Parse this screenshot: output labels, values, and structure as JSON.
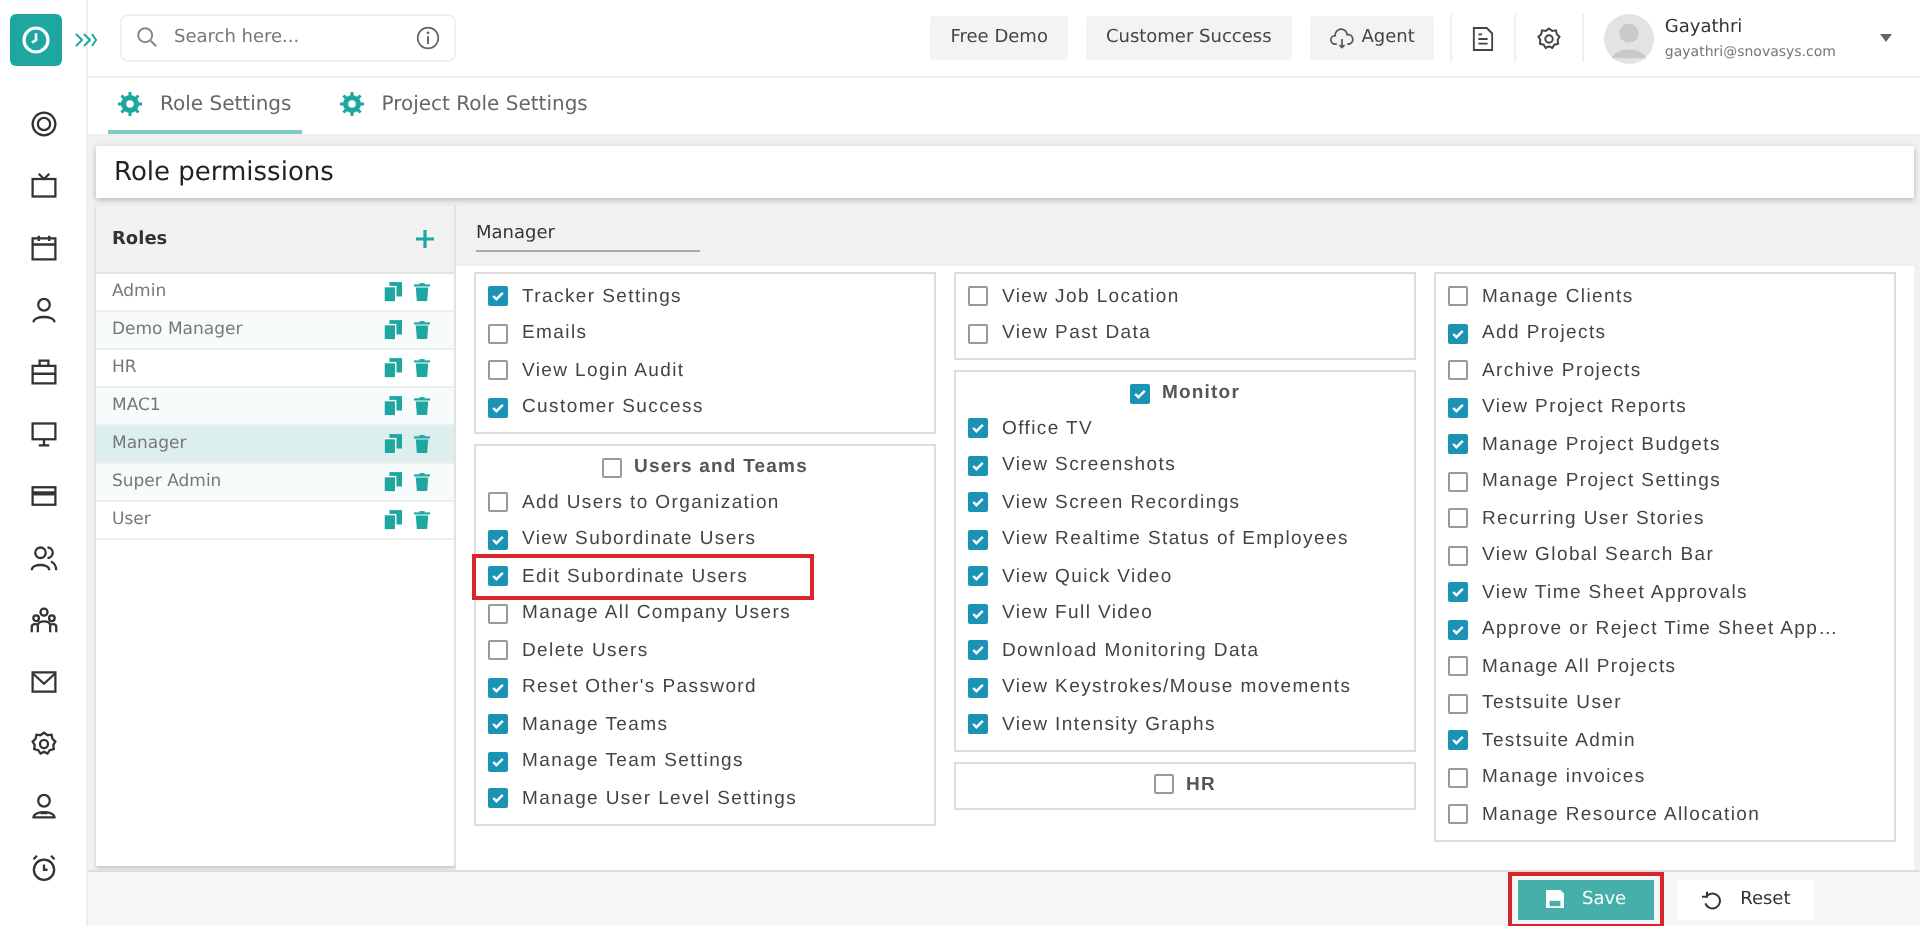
{
  "header": {
    "search_placeholder": "Search here...",
    "buttons": [
      {
        "label": "Free Demo",
        "kind": "plain"
      },
      {
        "label": "Customer Success",
        "kind": "plain"
      },
      {
        "label": "Agent",
        "kind": "cloud"
      }
    ],
    "user": {
      "name": "Gayathri",
      "email": "gayathri@snovasys.com"
    }
  },
  "tabs": [
    {
      "label": "Role Settings",
      "selected": true
    },
    {
      "label": "Project Role Settings",
      "selected": false
    }
  ],
  "page_title": "Role permissions",
  "roles": {
    "title": "Roles",
    "items": [
      {
        "name": "Admin",
        "selected": false
      },
      {
        "name": "Demo Manager",
        "selected": false
      },
      {
        "name": "HR",
        "selected": false
      },
      {
        "name": "MAC1",
        "selected": false
      },
      {
        "name": "Manager",
        "selected": true
      },
      {
        "name": "Super Admin",
        "selected": false
      },
      {
        "name": "User",
        "selected": false
      }
    ]
  },
  "role_select": {
    "value": "Manager"
  },
  "columns": [
    {
      "groups": [
        {
          "items": [
            {
              "label": "Tracker Settings",
              "checked": true,
              "highlighted": false
            },
            {
              "label": "Emails",
              "checked": false,
              "highlighted": false
            },
            {
              "label": "View Login Audit",
              "checked": false,
              "highlighted": false
            },
            {
              "label": "Customer Success",
              "checked": true,
              "highlighted": false
            }
          ]
        },
        {
          "title": "Users and Teams",
          "checked": false,
          "items": [
            {
              "label": "Add Users to Organization",
              "checked": false,
              "highlighted": false
            },
            {
              "label": "View Subordinate Users",
              "checked": true,
              "highlighted": false
            },
            {
              "label": "Edit Subordinate Users",
              "checked": true,
              "highlighted": true
            },
            {
              "label": "Manage All Company Users",
              "checked": false,
              "highlighted": false
            },
            {
              "label": "Delete Users",
              "checked": false,
              "highlighted": false
            },
            {
              "label": "Reset Other's Password",
              "checked": true,
              "highlighted": false
            },
            {
              "label": "Manage Teams",
              "checked": true,
              "highlighted": false
            },
            {
              "label": "Manage Team Settings",
              "checked": true,
              "highlighted": false
            },
            {
              "label": "Manage User Level Settings",
              "checked": true,
              "highlighted": false
            }
          ]
        }
      ]
    },
    {
      "groups": [
        {
          "items": [
            {
              "label": "View Job Location",
              "checked": false,
              "highlighted": false
            },
            {
              "label": "View Past Data",
              "checked": false,
              "highlighted": false
            }
          ]
        },
        {
          "title": "Monitor",
          "checked": true,
          "items": [
            {
              "label": "Office TV",
              "checked": true,
              "highlighted": false
            },
            {
              "label": "View Screenshots",
              "checked": true,
              "highlighted": false
            },
            {
              "label": "View Screen Recordings",
              "checked": true,
              "highlighted": false
            },
            {
              "label": "View Realtime Status of Employees",
              "checked": true,
              "highlighted": false
            },
            {
              "label": "View Quick Video",
              "checked": true,
              "highlighted": false
            },
            {
              "label": "View Full Video",
              "checked": true,
              "highlighted": false
            },
            {
              "label": "Download Monitoring Data",
              "checked": true,
              "highlighted": false
            },
            {
              "label": "View Keystrokes/Mouse movements",
              "checked": true,
              "highlighted": false
            },
            {
              "label": "View Intensity Graphs",
              "checked": true,
              "highlighted": false
            }
          ]
        },
        {
          "title": "HR",
          "checked": false
        }
      ]
    },
    {
      "groups": [
        {
          "items": [
            {
              "label": "Manage Clients",
              "checked": false,
              "highlighted": false
            },
            {
              "label": "Add Projects",
              "checked": true,
              "highlighted": false
            },
            {
              "label": "Archive Projects",
              "checked": false,
              "highlighted": false
            },
            {
              "label": "View Project Reports",
              "checked": true,
              "highlighted": false
            },
            {
              "label": "Manage Project Budgets",
              "checked": true,
              "highlighted": false
            },
            {
              "label": "Manage Project Settings",
              "checked": false,
              "highlighted": false
            },
            {
              "label": "Recurring User Stories",
              "checked": false,
              "highlighted": false
            },
            {
              "label": "View Global Search Bar",
              "checked": false,
              "highlighted": false
            },
            {
              "label": "View Time Sheet Approvals",
              "checked": true,
              "highlighted": false
            },
            {
              "label": "Approve or Reject Time Sheet App…",
              "checked": true,
              "highlighted": false
            },
            {
              "label": "Manage All Projects",
              "checked": false,
              "highlighted": false
            },
            {
              "label": "Testsuite User",
              "checked": false,
              "highlighted": false
            },
            {
              "label": "Testsuite Admin",
              "checked": true,
              "highlighted": false
            },
            {
              "label": "Manage invoices",
              "checked": false,
              "highlighted": false
            },
            {
              "label": "Manage Resource Allocation",
              "checked": false,
              "highlighted": false
            }
          ]
        }
      ]
    }
  ],
  "footer": {
    "buttons": [
      {
        "label": "Save",
        "kind": "primary",
        "highlighted": true
      },
      {
        "label": "Reset",
        "kind": "secondary",
        "highlighted": false
      }
    ]
  }
}
